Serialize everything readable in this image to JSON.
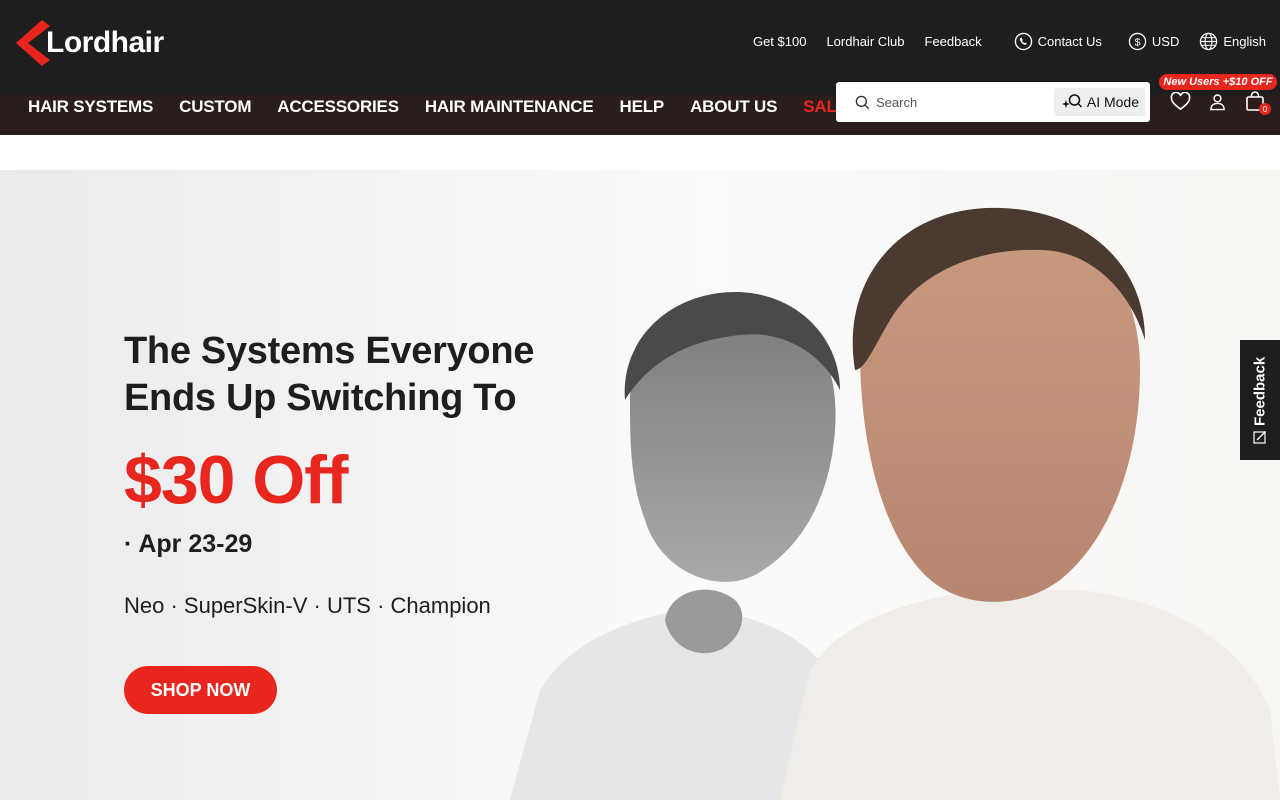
{
  "brand": {
    "name": "Lordhair",
    "accent_color": "#e8261d",
    "header_bg": "#1e1e1e"
  },
  "topbar": {
    "links": [
      {
        "label": "Get $100"
      },
      {
        "label": "Lordhair Club"
      },
      {
        "label": "Feedback"
      },
      {
        "label": "Contact Us",
        "icon": "phone-icon"
      },
      {
        "label": "USD",
        "icon": "dollar-icon"
      },
      {
        "label": "English",
        "icon": "globe-icon"
      }
    ]
  },
  "nav": {
    "items": [
      {
        "label": "HAIR SYSTEMS"
      },
      {
        "label": "CUSTOM"
      },
      {
        "label": "ACCESSORIES"
      },
      {
        "label": "HAIR MAINTENANCE"
      },
      {
        "label": "HELP"
      },
      {
        "label": "ABOUT US"
      },
      {
        "label": "SALE"
      }
    ]
  },
  "search": {
    "placeholder": "Search",
    "ai_mode_label": "AI Mode"
  },
  "header_icons": {
    "promo_badge": "New Users +$10 OFF",
    "cart_count": "0",
    "icons": [
      "heart-icon",
      "user-icon",
      "cart-icon"
    ]
  },
  "hero": {
    "title": "The Systems Everyone Ends Up Switching To",
    "discount": "$30 Off",
    "dates": "· Apr 23-29",
    "products": "Neo · SuperSkin-V · UTS · Champion",
    "cta_label": "SHOP NOW"
  },
  "feedback_tab": {
    "label": "Feedback"
  }
}
